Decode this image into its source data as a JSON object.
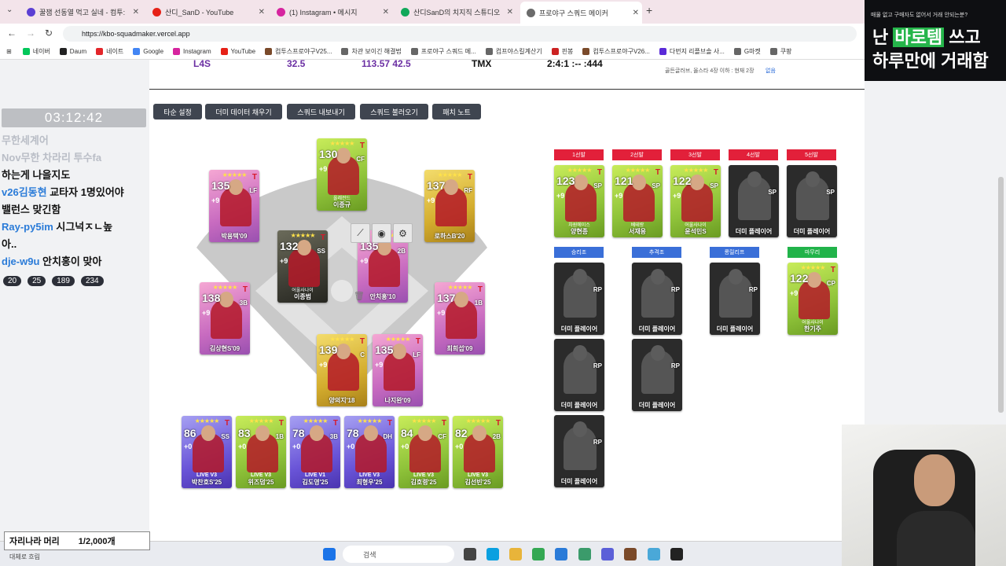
{
  "browser": {
    "tabs": [
      {
        "title": "꿀잼 선동열 먹고 실네 - 컴투:",
        "color": "#5b3fd3"
      },
      {
        "title": "산디_SanD - YouTube",
        "color": "#e62117"
      },
      {
        "title": "(1) Instagram • 메시지",
        "color": "#d6249f"
      },
      {
        "title": "산디SanD의 치지직 스튜디오",
        "color": "#11a85a"
      },
      {
        "title": "프로야구 스쿼드 메이커",
        "color": "#6b6b6b"
      }
    ],
    "new_tab": "+",
    "url": "https://kbo-squadmaker.vercel.app",
    "bookmarks": [
      "네이버",
      "Daum",
      "네이트",
      "Google",
      "Instagram",
      "YouTube",
      "컴투스프로야구V25...",
      "차관 보이긴 해결법",
      "프로야구 스쿼드 메...",
      "컴프야스킬계산기",
      "핀봉",
      "컴투스프로야구V26...",
      "다번지 리플브솔 사...",
      "G마켓",
      "쿠팡"
    ]
  },
  "top_stats": {
    "values": [
      "L4S",
      "32.5",
      "113.57 42.5",
      "TMX",
      "2:4:1 :-- :444",
      "0"
    ],
    "note": "골든글러브, 올스타 4장 이하 : 현재 2장",
    "none_label": "없음"
  },
  "buttons": [
    "타순 설정",
    "더미 데이터 채우기",
    "스쿼드 내보내기",
    "스쿼드 불러오기",
    "패치 노트"
  ],
  "fielders": [
    {
      "ovr": "130",
      "pos": "CF",
      "plus": "+9",
      "sub": "올레전드",
      "name": "이종규",
      "grad": "green"
    },
    {
      "ovr": "135",
      "pos": "LF",
      "plus": "+9",
      "sub": "",
      "name": "박용택'09",
      "grad": "pink"
    },
    {
      "ovr": "137",
      "pos": "RF",
      "plus": "+9",
      "sub": "",
      "name": "로하스B'20",
      "grad": "gold"
    },
    {
      "ovr": "132",
      "pos": "SS",
      "plus": "+9",
      "sub": "어울사나이",
      "name": "이종범",
      "grad": "dark"
    },
    {
      "ovr": "135",
      "pos": "2B",
      "plus": "+9",
      "sub": "",
      "name": "안치홍'10",
      "grad": "pink"
    },
    {
      "ovr": "138",
      "pos": "3B",
      "plus": "+9",
      "sub": "",
      "name": "김상현S'09",
      "grad": "pink"
    },
    {
      "ovr": "137",
      "pos": "1B",
      "plus": "+9",
      "sub": "",
      "name": "최희섭'09",
      "grad": "pink"
    },
    {
      "ovr": "139",
      "pos": "C",
      "plus": "+9",
      "sub": "",
      "name": "양의지'18",
      "grad": "gold"
    },
    {
      "ovr": "135",
      "pos": "LF",
      "plus": "+9",
      "sub": "",
      "name": "나지완'09",
      "grad": "pink"
    }
  ],
  "bench": [
    {
      "ovr": "86",
      "pos": "SS",
      "plus": "+0",
      "sub": "LIVE V3",
      "name": "박찬호S'25",
      "grad": "purple"
    },
    {
      "ovr": "83",
      "pos": "1B",
      "plus": "+0",
      "sub": "LIVE V3",
      "name": "위즈덤'25",
      "grad": "green"
    },
    {
      "ovr": "78",
      "pos": "3B",
      "plus": "+0",
      "sub": "LIVE V1",
      "name": "김도영'25",
      "grad": "purple"
    },
    {
      "ovr": "78",
      "pos": "DH",
      "plus": "+0",
      "sub": "LIVE V3",
      "name": "최형우'25",
      "grad": "purple"
    },
    {
      "ovr": "84",
      "pos": "CF",
      "plus": "+0",
      "sub": "LIVE V3",
      "name": "김호령'25",
      "grad": "green"
    },
    {
      "ovr": "82",
      "pos": "2B",
      "plus": "+0",
      "sub": "LIVE V3",
      "name": "김선빈'25",
      "grad": "green"
    }
  ],
  "starters_labels": [
    "1선발",
    "2선발",
    "3선발",
    "4선발",
    "5선발"
  ],
  "starters": [
    {
      "ovr": "123",
      "pos": "SP",
      "plus": "+9",
      "sub": "차원에이스",
      "name": "양현종",
      "grad": "green"
    },
    {
      "ovr": "121",
      "pos": "SP",
      "plus": "+9",
      "sub": "베테랑",
      "name": "서재응",
      "grad": "green"
    },
    {
      "ovr": "122",
      "pos": "SP",
      "plus": "+9",
      "sub": "어울사나이",
      "name": "윤석민S",
      "grad": "green"
    },
    {
      "ovr": "",
      "pos": "SP",
      "plus": "",
      "sub": "",
      "name": "더미 플레이어",
      "grad": "black"
    },
    {
      "ovr": "",
      "pos": "SP",
      "plus": "",
      "sub": "",
      "name": "더미 플레이어",
      "grad": "black"
    }
  ],
  "relief_labels": [
    "승리조",
    "추격조",
    "롱릴리프",
    "마무리"
  ],
  "relievers": [
    {
      "pos": "RP",
      "name": "더미 플레이어"
    },
    {
      "pos": "RP",
      "name": "더미 플레이어"
    },
    {
      "pos": "RP",
      "name": "더미 플레이어"
    },
    {
      "pos": "RP",
      "name": "더미 플레이어"
    },
    {
      "pos": "RP",
      "name": "더미 플레이어"
    },
    {
      "pos": "RP",
      "name": "더미 플레이어"
    }
  ],
  "closer": {
    "ovr": "122",
    "pos": "CP",
    "plus": "+9",
    "sub": "어울사나이",
    "name": "한기주",
    "grad": "green"
  },
  "stream": {
    "timer": "03:12:42",
    "chat": [
      {
        "user": "",
        "text": "무한세계어"
      },
      {
        "user": "Nov무한",
        "text": "차라리 투수fa"
      },
      {
        "user": "",
        "text": "하는게 나을지도"
      },
      {
        "user": "v26김동현",
        "text": "교타자 1명있어야"
      },
      {
        "user": "",
        "text": "밸런스 맞긴함"
      },
      {
        "user": "Ray-py5im",
        "text": "시그넉ㅈㄴ높"
      },
      {
        "user": "",
        "text": "아.."
      },
      {
        "user": "dje-w9u",
        "text": "안치홍이 맞아"
      }
    ],
    "counters": [
      "20",
      "25",
      "189",
      "234"
    ],
    "ad_small": "매물 없고 구매자도 없어서 거래 안되는분?",
    "ad_line1_a": "난 ",
    "ad_line1_hl": "바로템",
    "ad_line1_b": " 쓰고",
    "ad_line2": "하루만에 거래함",
    "goal_label": "자리나라 머리",
    "goal_value": "1/2,000개"
  },
  "taskbar": {
    "search": "검색",
    "weather": "대체로 흐림"
  }
}
